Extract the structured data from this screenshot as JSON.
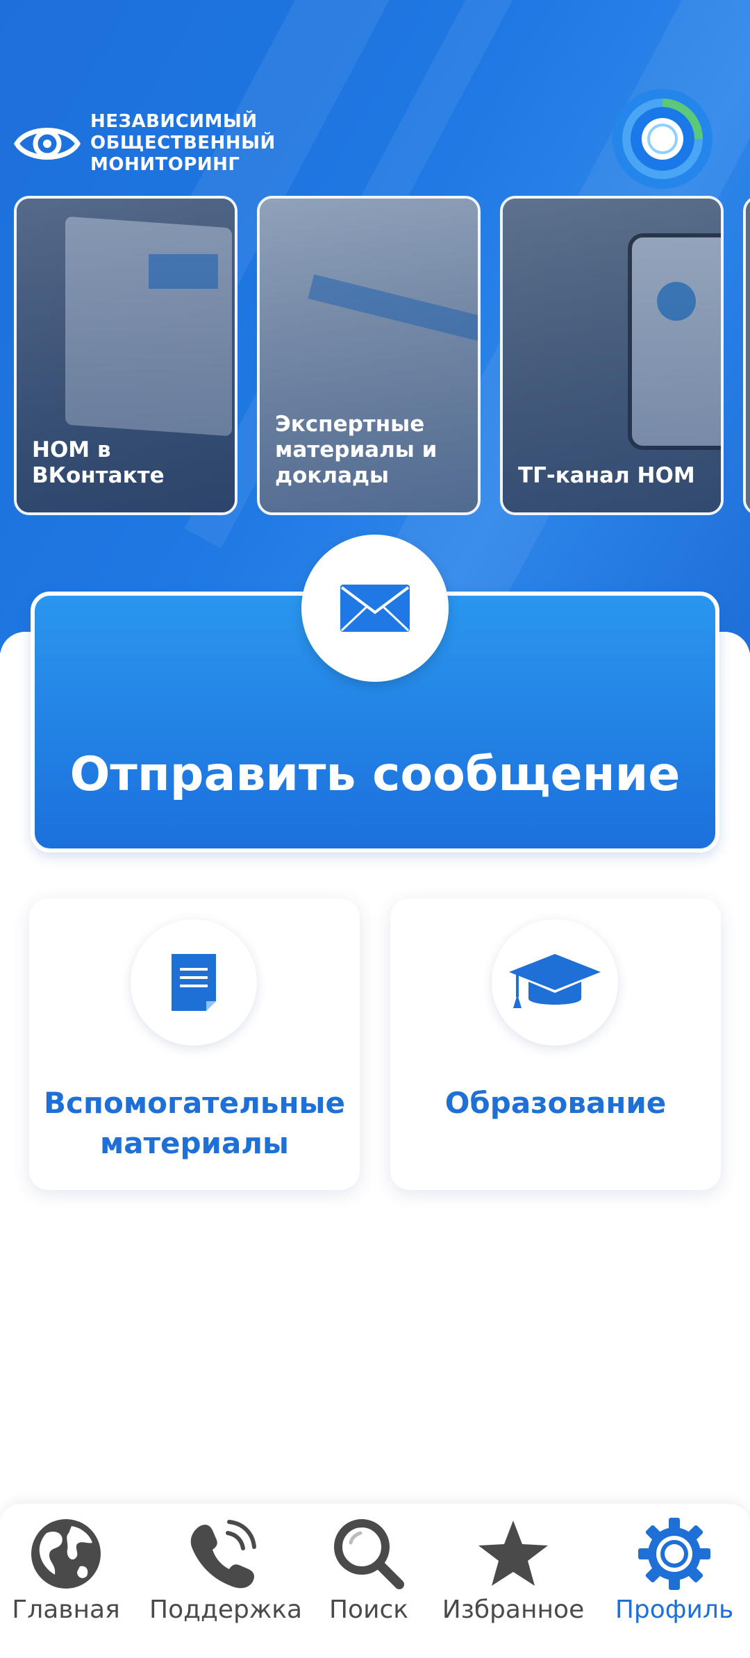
{
  "header": {
    "logo_lines": [
      "НЕЗАВИСИМЫЙ",
      "ОБЩЕСТВЕННЫЙ",
      "МОНИТОРИНГ"
    ],
    "profile_progress_icon": "progress-ring-icon"
  },
  "cards": [
    {
      "label": "НОМ в ВКонтакте",
      "icon": "laptop-image"
    },
    {
      "label": "Экспертные материалы и доклады",
      "icon": "document-image"
    },
    {
      "label": "ТГ-канал НОМ",
      "icon": "phone-image"
    }
  ],
  "send_message": {
    "label": "Отправить сообщение",
    "icon": "mail-icon"
  },
  "tiles": [
    {
      "label": "Вспомогательные материалы",
      "icon": "document-icon"
    },
    {
      "label": "Образование",
      "icon": "graduation-cap-icon"
    }
  ],
  "nav": [
    {
      "label": "Главная",
      "icon": "globe-icon"
    },
    {
      "label": "Поддержка",
      "icon": "phone-icon"
    },
    {
      "label": "Поиск",
      "icon": "search-icon"
    },
    {
      "label": "Избранное",
      "icon": "star-icon"
    },
    {
      "label": "Профиль",
      "icon": "gear-icon",
      "active": true
    }
  ],
  "colors": {
    "brand_blue": "#1f70d6",
    "hero_blue": "#1e6fd9",
    "nav_inactive": "#4a4a4a"
  }
}
